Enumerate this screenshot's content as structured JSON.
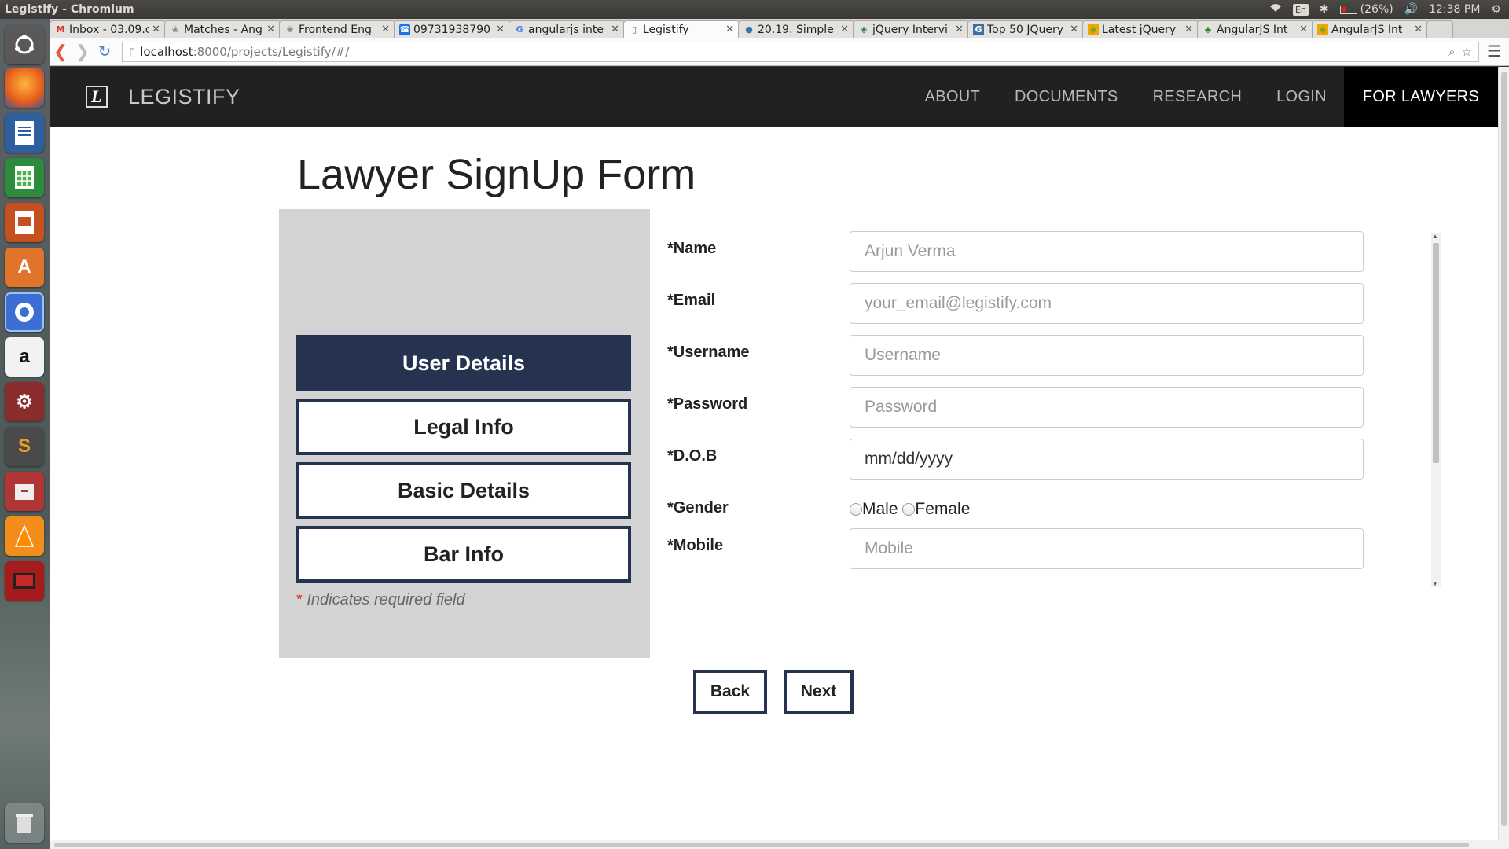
{
  "window": {
    "title": "Legistify - Chromium"
  },
  "system_tray": {
    "keyboard": "En",
    "battery": "(26%)",
    "time": "12:38 PM"
  },
  "tabs": [
    {
      "label": "Inbox - 03.09.c",
      "icon": "gmail-icon"
    },
    {
      "label": "Matches - Ang",
      "icon": "flame-icon"
    },
    {
      "label": "Frontend Eng",
      "icon": "flame-icon"
    },
    {
      "label": "09731938790 ,",
      "icon": "phone-icon"
    },
    {
      "label": "angularjs inte",
      "icon": "google-icon"
    },
    {
      "label": "Legistify",
      "icon": "page-icon",
      "active": true
    },
    {
      "label": "20.19. Simple",
      "icon": "python-icon"
    },
    {
      "label": "jQuery Intervi",
      "icon": "diamond-icon"
    },
    {
      "label": "Top 50 JQuery",
      "icon": "g-icon"
    },
    {
      "label": "Latest jQuery",
      "icon": "badge-icon"
    },
    {
      "label": "AngularJS Int",
      "icon": "diamond-icon"
    },
    {
      "label": "AngularJS Int",
      "icon": "badge-icon"
    }
  ],
  "address_bar": {
    "host": "localhost",
    "path": ":8000/projects/Legistify/#/"
  },
  "site": {
    "brand": "LEGISTIFY",
    "logo_letter": "L",
    "nav": [
      "ABOUT",
      "DOCUMENTS",
      "RESEARCH",
      "LOGIN",
      "FOR LAWYERS"
    ],
    "active_nav": "FOR LAWYERS"
  },
  "form": {
    "title": "Lawyer SignUp Form",
    "steps": [
      "User Details",
      "Legal Info",
      "Basic Details",
      "Bar Info"
    ],
    "active_step": "User Details",
    "required_note": "Indicates required field",
    "required_marker": "*",
    "fields": {
      "name": {
        "label": "*Name",
        "placeholder": "Arjun Verma"
      },
      "email": {
        "label": "*Email",
        "placeholder": "your_email@legistify.com"
      },
      "username": {
        "label": "*Username",
        "placeholder": "Username"
      },
      "password": {
        "label": "*Password",
        "placeholder": "Password"
      },
      "dob": {
        "label": "*D.O.B",
        "placeholder": "mm/dd/yyyy"
      },
      "gender": {
        "label": "*Gender",
        "options": [
          "Male",
          "Female"
        ]
      },
      "mobile": {
        "label": "*Mobile",
        "placeholder": "Mobile"
      }
    },
    "buttons": {
      "back": "Back",
      "next": "Next"
    }
  }
}
